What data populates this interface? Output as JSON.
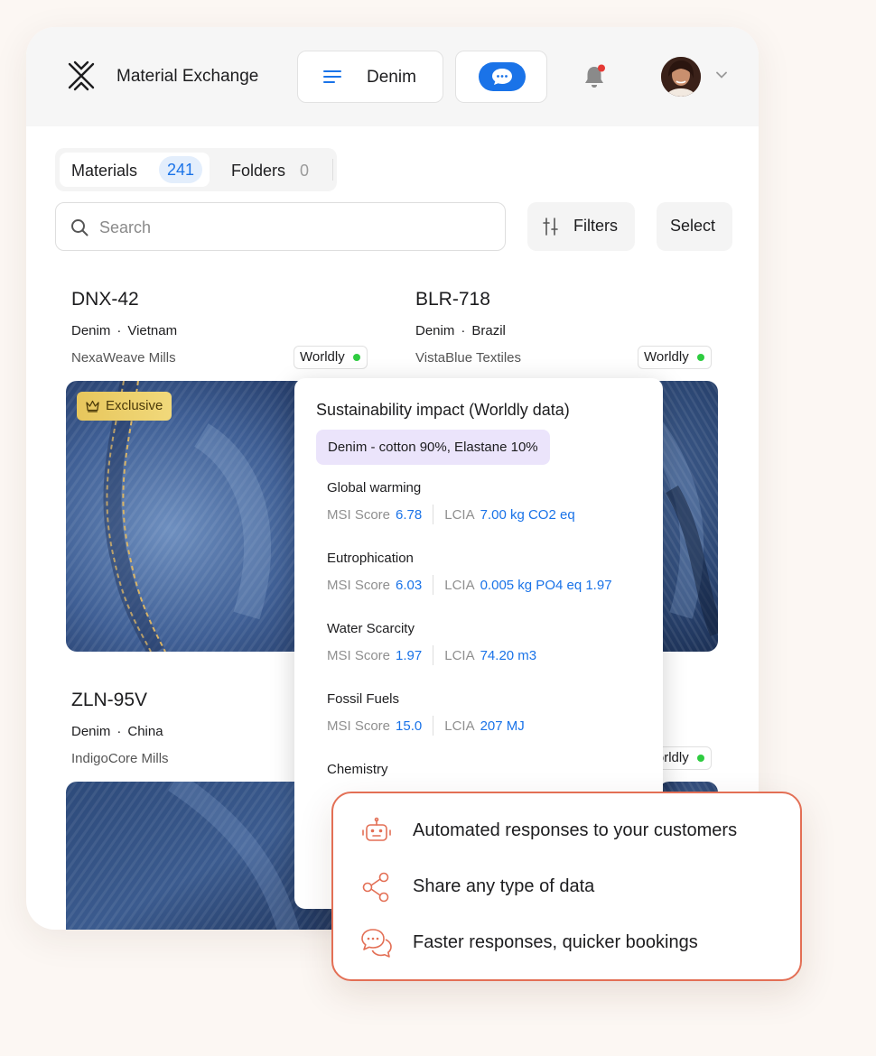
{
  "header": {
    "app_title": "Material Exchange",
    "category_label": "Denim",
    "logo_icon": "x-mark-logo-icon",
    "menu_icon": "menu-lines-icon",
    "chat_icon": "chat-bubble-icon",
    "bell_icon": "bell-icon",
    "accent_color": "#1a73e8",
    "notification_dot_color": "#e53935"
  },
  "tabs": [
    {
      "label": "Materials",
      "count": "241"
    },
    {
      "label": "Folders",
      "count": "0"
    }
  ],
  "search": {
    "placeholder": "Search",
    "value": ""
  },
  "toolbar": {
    "filters_label": "Filters",
    "select_label": "Select"
  },
  "cards": [
    {
      "code": "DNX-42",
      "material": "Denim",
      "country": "Vietnam",
      "mill": "NexaWeave Mills",
      "badge": "Worldly",
      "tag": "Exclusive"
    },
    {
      "code": "BLR-718",
      "material": "Denim",
      "country": "Brazil",
      "mill": "VistaBlue Textiles",
      "badge": "Worldly"
    },
    {
      "code": "ZLN-95V",
      "material": "Denim",
      "country": "China",
      "mill": "IndigoCore Mills",
      "badge": "Worldly"
    }
  ],
  "popup": {
    "title": "Sustainability impact (Worldly data)",
    "composition": "Denim - cotton 90%, Elastane 10%",
    "msi_label": "MSI Score",
    "lcia_label": "LCIA",
    "metrics": [
      {
        "name": "Global warming",
        "msi": "6.78",
        "lcia": "7.00 kg CO2 eq"
      },
      {
        "name": "Eutrophication",
        "msi": "6.03",
        "lcia": "0.005 kg PO4 eq 1.97"
      },
      {
        "name": "Water Scarcity",
        "msi": "1.97",
        "lcia": "74.20 m3"
      },
      {
        "name": "Fossil Fuels",
        "msi": "15.0",
        "lcia": "207 MJ"
      },
      {
        "name": "Chemistry"
      }
    ]
  },
  "features": [
    {
      "icon": "robot-icon",
      "text": "Automated responses to your customers"
    },
    {
      "icon": "share-icon",
      "text": "Share any type of data"
    },
    {
      "icon": "chat-bubbles-icon",
      "text": "Faster responses, quicker bookings"
    }
  ],
  "colors": {
    "feature_border": "#e36f55",
    "worldly_dot": "#2ecc40",
    "exclusive_gold": "#e7c65c"
  }
}
